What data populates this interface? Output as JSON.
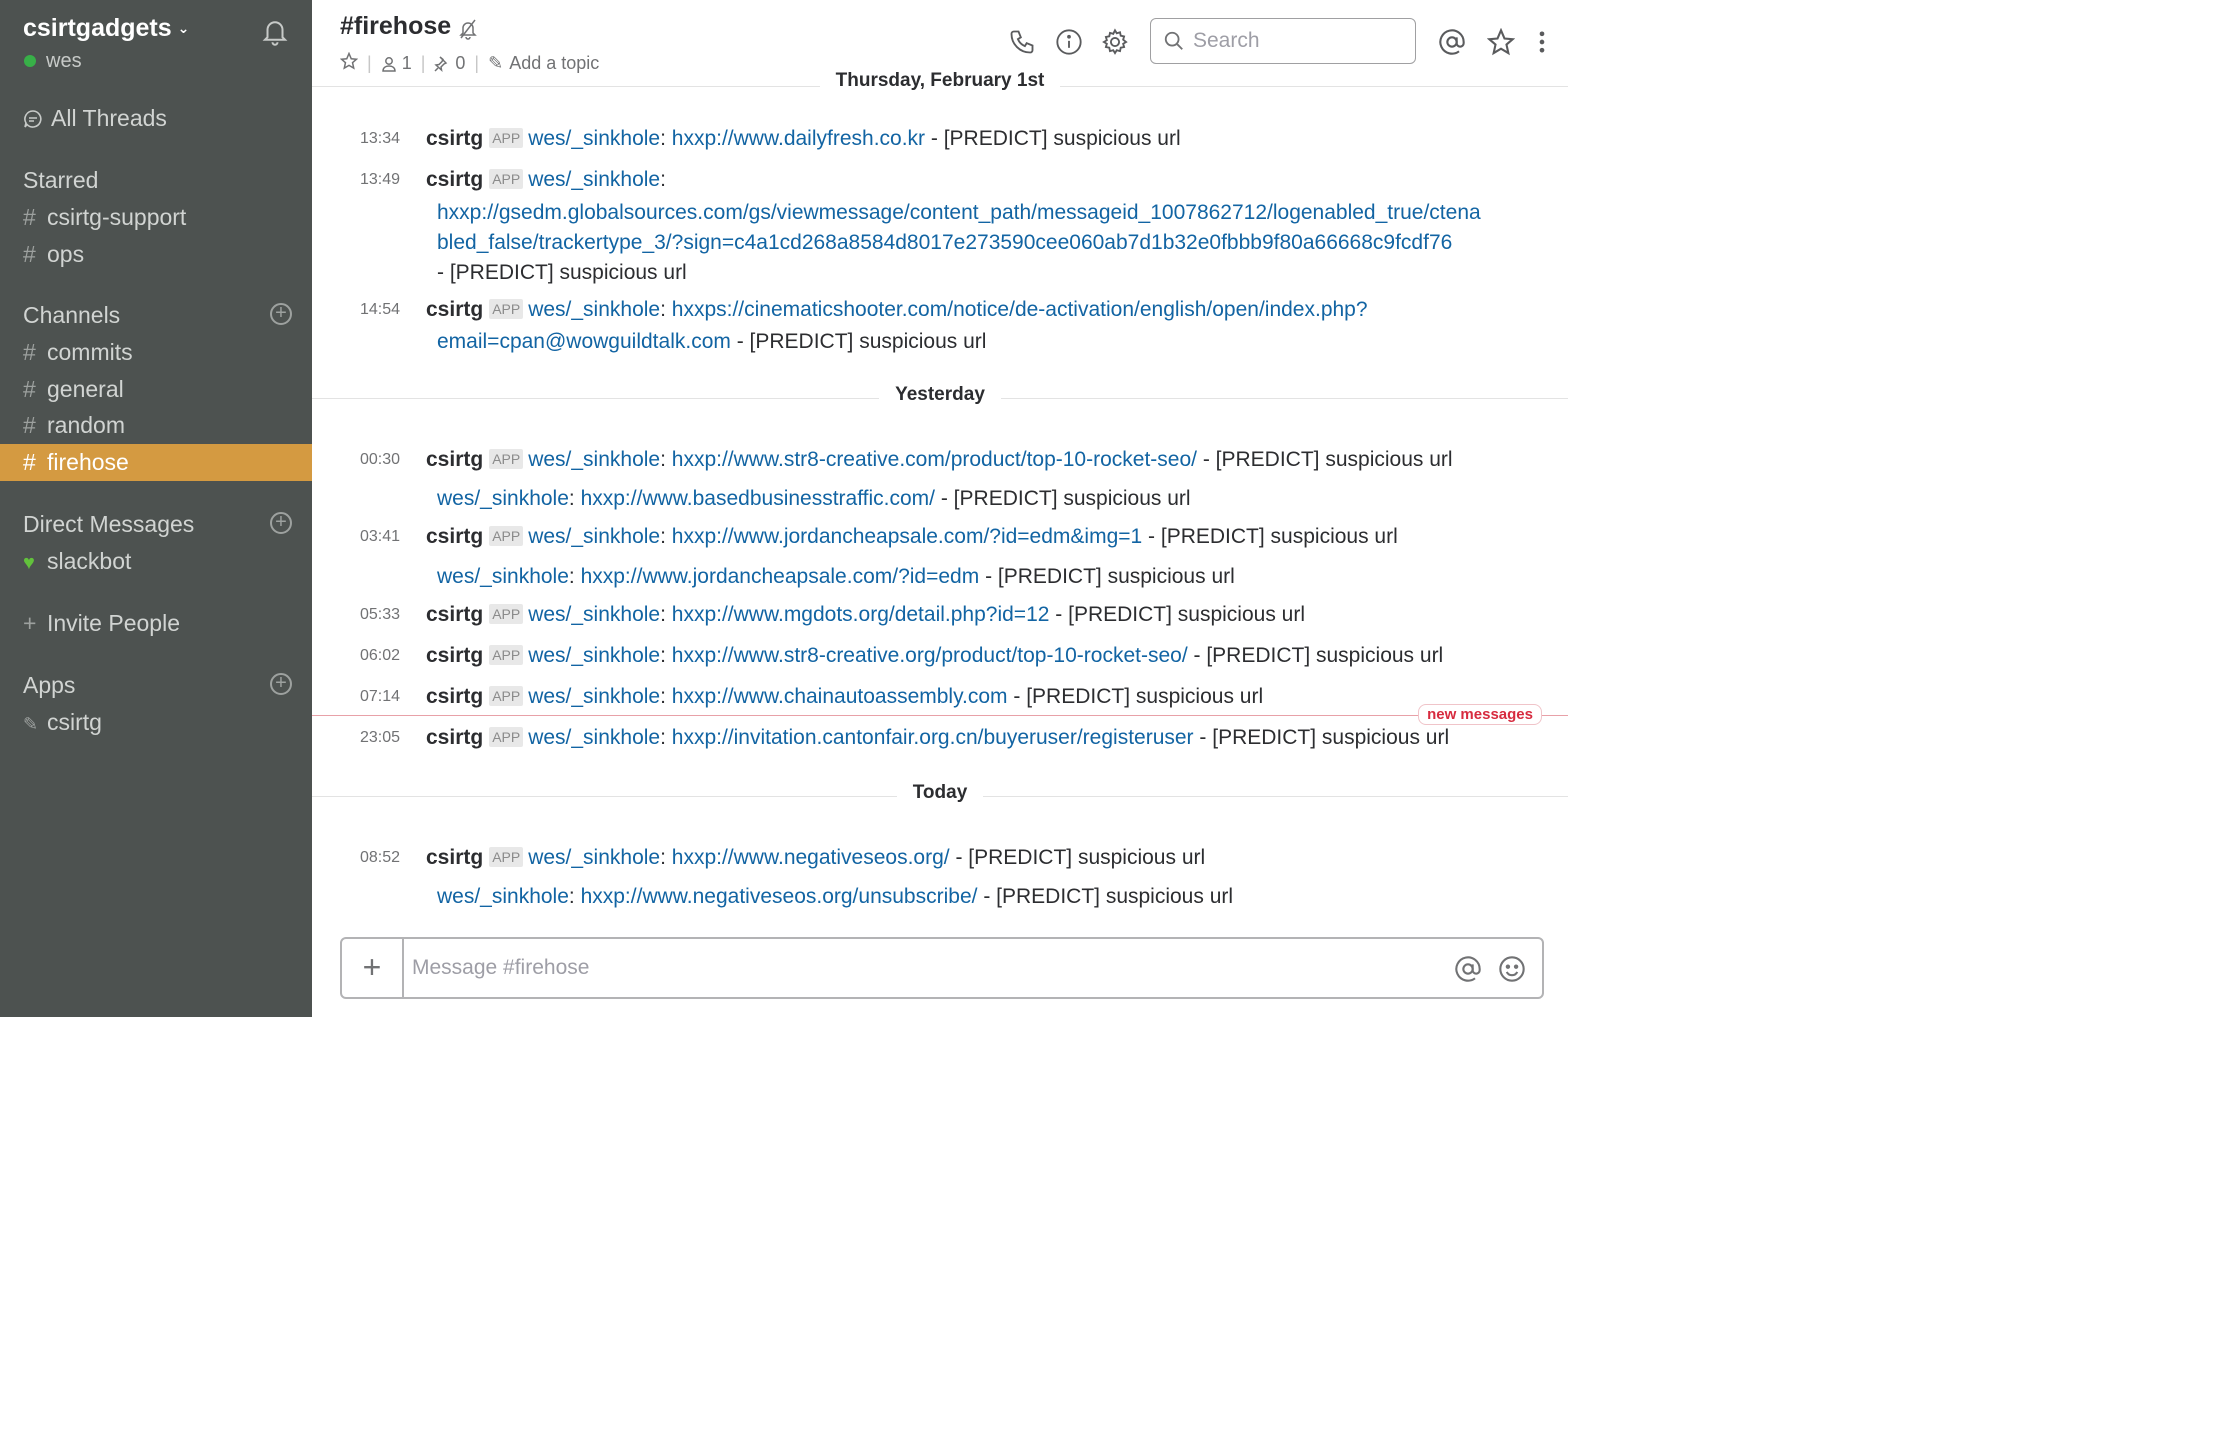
{
  "sidebar": {
    "team_name": "csirtgadgets",
    "user": "wes",
    "all_threads": "All Threads",
    "starred_label": "Starred",
    "starred": [
      "csirtg-support",
      "ops"
    ],
    "channels_label": "Channels",
    "channels": [
      "commits",
      "general",
      "random",
      "firehose"
    ],
    "active_channel": "firehose",
    "dm_label": "Direct Messages",
    "dms": [
      "slackbot"
    ],
    "invite": "Invite People",
    "apps_label": "Apps",
    "apps": [
      "csirtg"
    ]
  },
  "header": {
    "channel_name": "#firehose",
    "member_count": "1",
    "pinned_count": "0",
    "topic_placeholder": "Add a topic",
    "search_placeholder": "Search"
  },
  "days": {
    "d1": "Thursday, February 1st",
    "d2": "Yesterday",
    "d3": "Today"
  },
  "messages": {
    "author": "csirtg",
    "badge": "APP",
    "source": "wes/_sinkhole",
    "suffix": "- [PREDICT] suspicious url",
    "m1": {
      "time": "13:34",
      "url": "hxxp://www.dailyfresh.co.kr"
    },
    "m2": {
      "time": "13:49",
      "url_line1": "hxxp://gsedm.globalsources.com/gs/viewmessage/content_path/messageid_1007862712/logenabled_true/ctena",
      "url_line2": "bled_false/trackertype_3/?sign=c4a1cd268a8584d8017e273590cee060ab7d1b32e0fbbb9f80a66668c9fcdf76"
    },
    "m3": {
      "time": "14:54",
      "url_line1": "hxxps://cinematicshooter.com/notice/de-activation/english/open/index.php?",
      "url_line2": "email=cpan@wowguildtalk.com"
    },
    "m4": {
      "time": "00:30",
      "url": "hxxp://www.str8-creative.com/product/top-10-rocket-seo/"
    },
    "m4b": {
      "url": "hxxp://www.basedbusinesstraffic.com/"
    },
    "m5": {
      "time": "03:41",
      "url": "hxxp://www.jordancheapsale.com/?id=edm&img=1"
    },
    "m5b": {
      "url": "hxxp://www.jordancheapsale.com/?id=edm"
    },
    "m6": {
      "time": "05:33",
      "url": "hxxp://www.mgdots.org/detail.php?id=12"
    },
    "m7": {
      "time": "06:02",
      "url": "hxxp://www.str8-creative.org/product/top-10-rocket-seo/"
    },
    "m8": {
      "time": "07:14",
      "url": "hxxp://www.chainautoassembly.com"
    },
    "m9": {
      "time": "23:05",
      "url": "hxxp://invitation.cantonfair.org.cn/buyeruser/registeruser"
    },
    "m10": {
      "time": "08:52",
      "url": "hxxp://www.negativeseos.org/"
    },
    "m10b": {
      "url": "hxxp://www.negativeseos.org/unsubscribe/"
    }
  },
  "new_messages_label": "new messages",
  "composer": {
    "placeholder": "Message #firehose"
  },
  "colors": {
    "sidebar_bg": "#4d5250",
    "active_channel": "#d49a41",
    "link": "#1264a3",
    "new_messages": "#d72b3f"
  }
}
